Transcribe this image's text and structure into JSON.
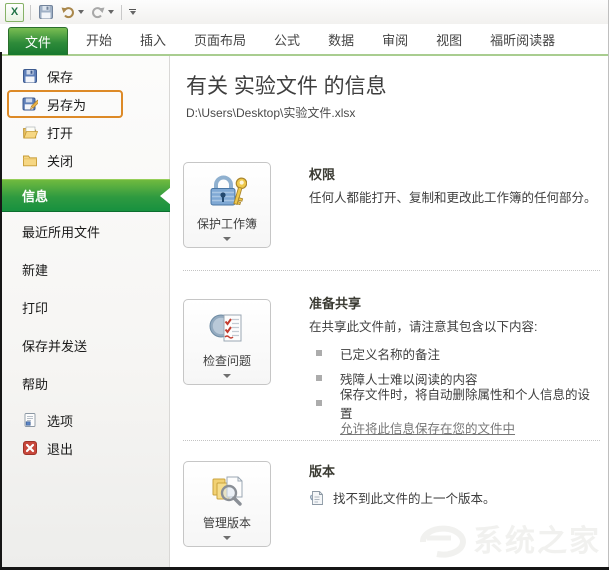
{
  "titlebar": {
    "icons": [
      "excel-logo",
      "save",
      "undo",
      "redo",
      "qat-menu"
    ]
  },
  "tabs": {
    "active": "文件",
    "items": [
      {
        "label": "文件"
      },
      {
        "label": "开始"
      },
      {
        "label": "插入"
      },
      {
        "label": "页面布局"
      },
      {
        "label": "公式"
      },
      {
        "label": "数据"
      },
      {
        "label": "审阅"
      },
      {
        "label": "视图"
      },
      {
        "label": "福昕阅读器"
      }
    ]
  },
  "sidebar": {
    "items": [
      {
        "label": "保存",
        "icon": "save-disk"
      },
      {
        "label": "另存为",
        "icon": "save-as-disk",
        "highlighted": true
      },
      {
        "label": "打开",
        "icon": "open-folder"
      },
      {
        "label": "关闭",
        "icon": "closed-folder"
      },
      {
        "label": "信息",
        "selected": true
      },
      {
        "label": "最近所用文件"
      },
      {
        "label": "新建"
      },
      {
        "label": "打印"
      },
      {
        "label": "保存并发送"
      },
      {
        "label": "帮助"
      },
      {
        "label": "选项",
        "icon": "options-document"
      },
      {
        "label": "退出",
        "icon": "exit-x"
      }
    ]
  },
  "main": {
    "title": "有关 实验文件 的信息",
    "path": "D:\\Users\\Desktop\\实验文件.xlsx",
    "sections": [
      {
        "button_label": "保护工作簿",
        "icon": "lock-key",
        "heading": "权限",
        "description": "任何人都能打开、复制和更改此工作簿的任何部分。"
      },
      {
        "button_label": "检查问题",
        "icon": "inspect-document",
        "heading": "准备共享",
        "description": "在共享此文件前，请注意其包含以下内容:",
        "bullets": [
          "已定义名称的备注",
          "残障人士难以阅读的内容",
          "保存文件时，将自动删除属性和个人信息的设置"
        ],
        "link": "允许将此信息保存在您的文件中"
      },
      {
        "button_label": "管理版本",
        "icon": "versions-folders",
        "heading": "版本",
        "empty_text": "找不到此文件的上一个版本。"
      }
    ]
  },
  "watermark": {
    "text": "系统之家"
  },
  "colors": {
    "accent_green": "#1e7c34",
    "tab_underline_green": "#a9cd90",
    "highlight_orange": "#dd8a27",
    "selected_gradient_top": "#70ba3f",
    "selected_gradient_bottom": "#17913f",
    "link_gray": "#767676"
  }
}
